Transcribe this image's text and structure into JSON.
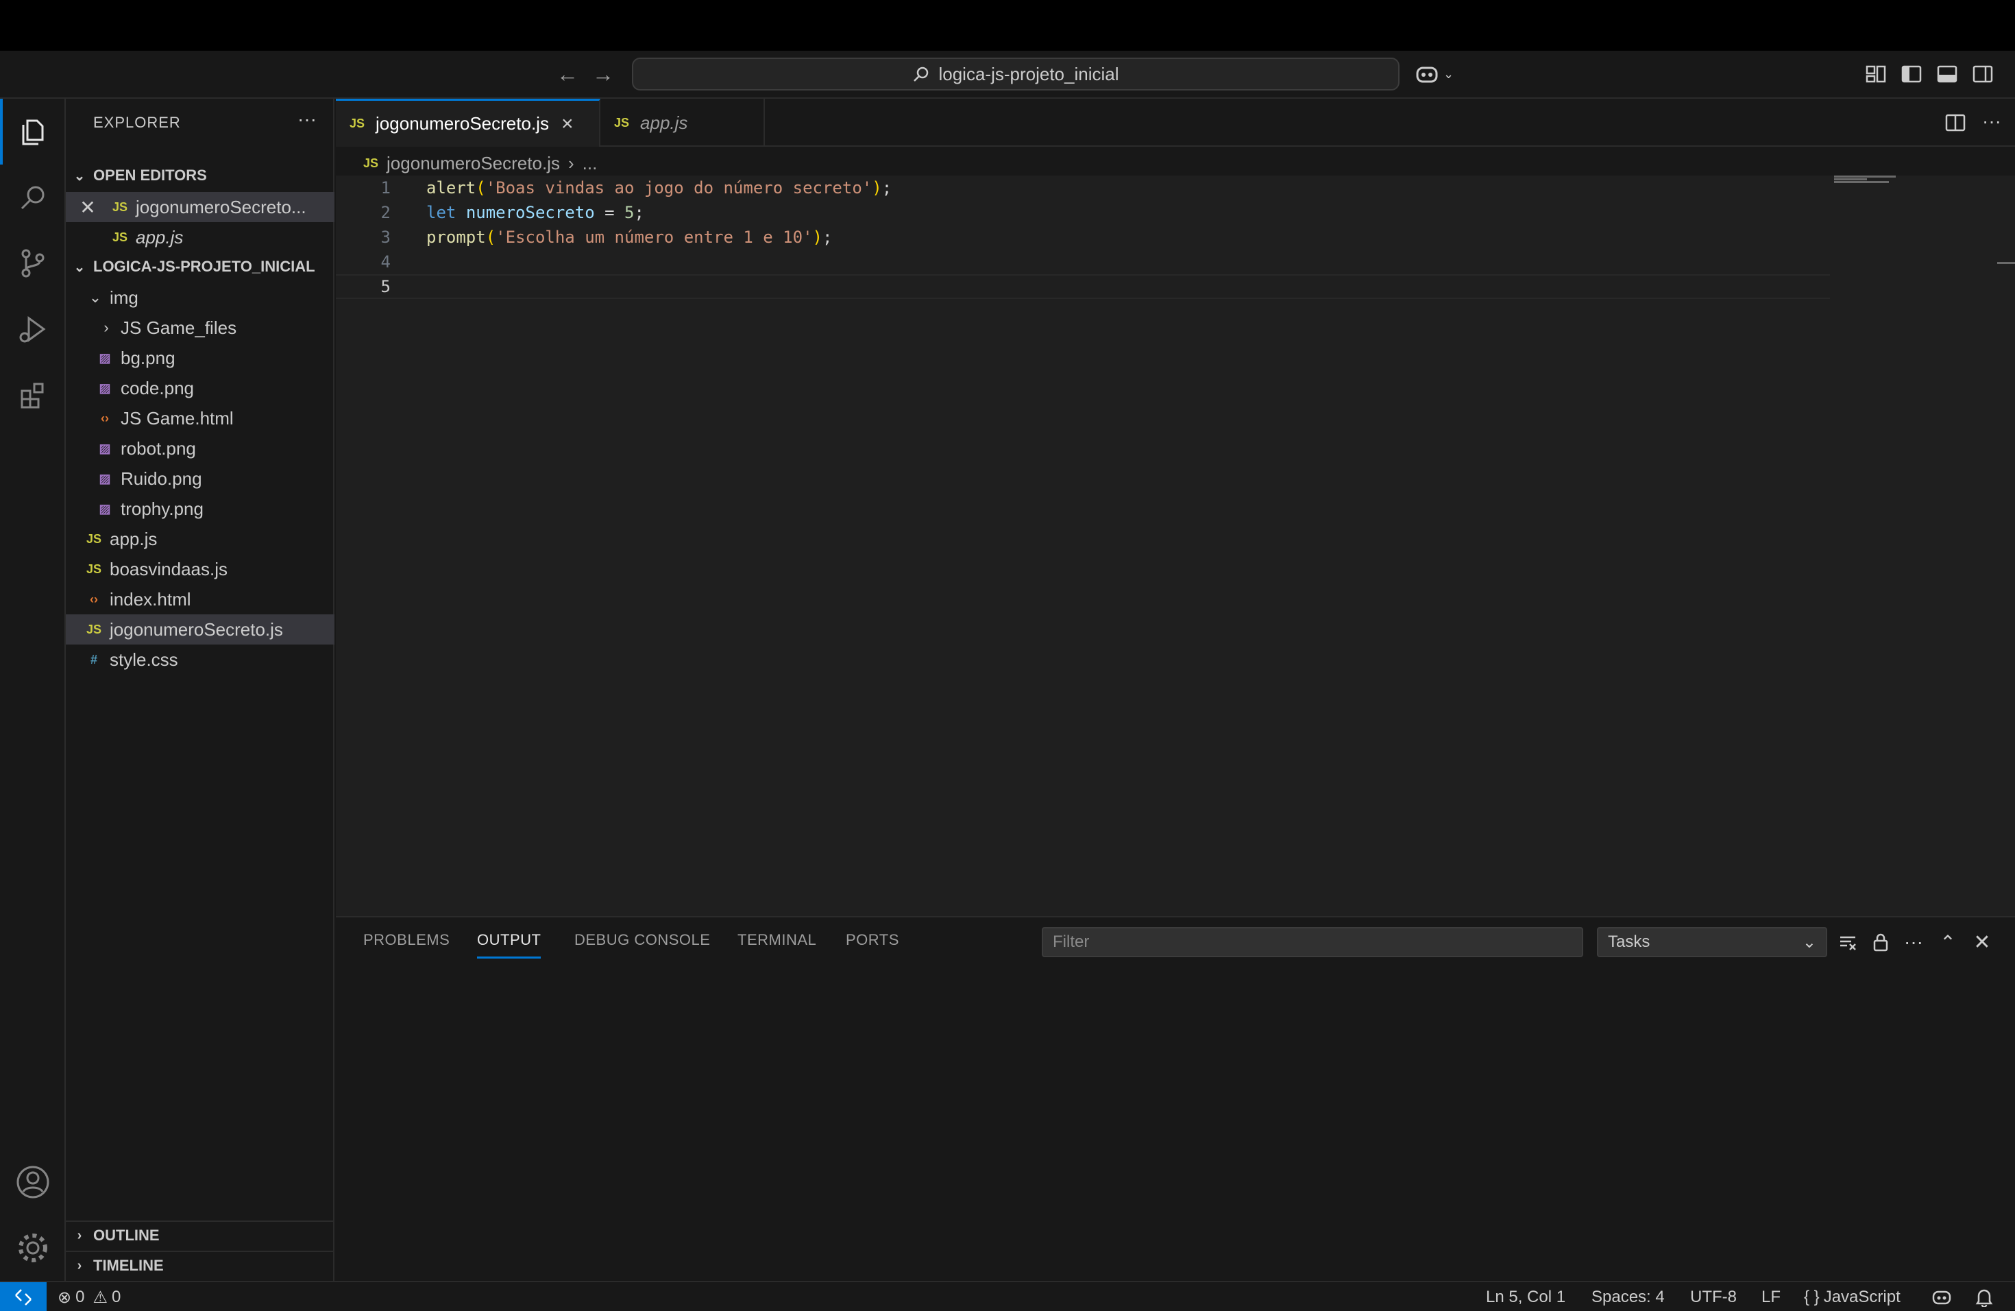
{
  "titlebar": {
    "search_label": "logica-js-projeto_inicial",
    "back_icon": "arrow-left-icon",
    "forward_icon": "arrow-right-icon"
  },
  "sidebar": {
    "title": "EXPLORER",
    "open_editors": {
      "header": "OPEN EDITORS",
      "items": [
        {
          "label": "jogonumeroSecreto...",
          "type": "js"
        },
        {
          "label": "app.js",
          "type": "js"
        }
      ]
    },
    "project": {
      "header": "LOGICA-JS-PROJETO_INICIAL",
      "tree": [
        {
          "label": "img",
          "kind": "folder-open"
        },
        {
          "label": "JS Game_files",
          "kind": "folder-closed"
        },
        {
          "label": "bg.png",
          "kind": "image"
        },
        {
          "label": "code.png",
          "kind": "image"
        },
        {
          "label": "JS Game.html",
          "kind": "html"
        },
        {
          "label": "robot.png",
          "kind": "image"
        },
        {
          "label": "Ruido.png",
          "kind": "image"
        },
        {
          "label": "trophy.png",
          "kind": "image"
        },
        {
          "label": "app.js",
          "kind": "js"
        },
        {
          "label": "boasvindaas.js",
          "kind": "js"
        },
        {
          "label": "index.html",
          "kind": "html"
        },
        {
          "label": "jogonumeroSecreto.js",
          "kind": "js"
        },
        {
          "label": "style.css",
          "kind": "css"
        }
      ]
    },
    "outline": "OUTLINE",
    "timeline": "TIMELINE"
  },
  "tabs": [
    {
      "label": "jogonumeroSecreto.js",
      "active": true
    },
    {
      "label": "app.js",
      "active": false
    }
  ],
  "breadcrumb": {
    "file": "jogonumeroSecreto.js",
    "rest": "..."
  },
  "editor": {
    "lines": [
      {
        "n": "1",
        "tokens": [
          [
            "fn",
            "alert"
          ],
          [
            "b1",
            "("
          ],
          [
            "str",
            "'Boas vindas ao jogo do número secreto'"
          ],
          [
            "b1",
            ")"
          ],
          [
            "p",
            ";"
          ]
        ]
      },
      {
        "n": "2",
        "tokens": [
          [
            "kw",
            "let"
          ],
          [
            "p",
            " "
          ],
          [
            "var",
            "numeroSecreto"
          ],
          [
            "p",
            " = "
          ],
          [
            "num",
            "5"
          ],
          [
            "p",
            ";"
          ]
        ]
      },
      {
        "n": "3",
        "tokens": [
          [
            "fn",
            "prompt"
          ],
          [
            "b1",
            "("
          ],
          [
            "str",
            "'Escolha um número entre 1 e 10'"
          ],
          [
            "b1",
            ")"
          ],
          [
            "p",
            ";"
          ]
        ]
      },
      {
        "n": "4",
        "tokens": []
      },
      {
        "n": "5",
        "tokens": []
      }
    ]
  },
  "panel": {
    "tabs": [
      "PROBLEMS",
      "OUTPUT",
      "DEBUG CONSOLE",
      "TERMINAL",
      "PORTS"
    ],
    "active_tab": "OUTPUT",
    "filter_placeholder": "Filter",
    "tasks_selected": "Tasks"
  },
  "statusbar": {
    "errors": "0",
    "warnings": "0",
    "position": "Ln 5, Col 1",
    "spaces": "Spaces: 4",
    "encoding": "UTF-8",
    "eol": "LF",
    "language": "JavaScript"
  },
  "colors": {
    "accent": "#0078d4",
    "js_icon": "#cbcb41",
    "image_icon": "#a074c4",
    "html_icon": "#e37933",
    "css_icon": "#519aba"
  }
}
